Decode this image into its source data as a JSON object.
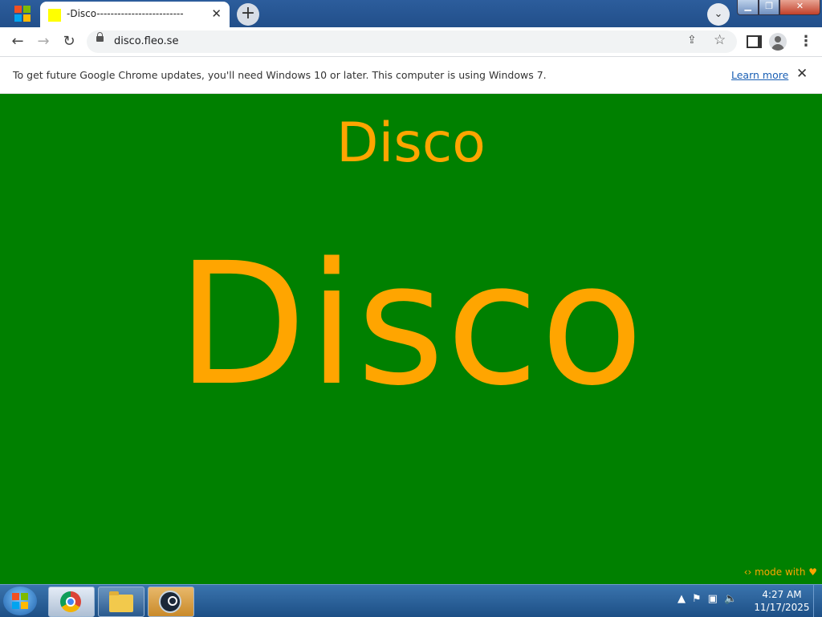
{
  "browser": {
    "tab_title": "-Disco-------------------------",
    "tab_close": "✕",
    "new_tab": "+",
    "url": "disco.fleo.se"
  },
  "toolbar": {
    "back": "←",
    "forward": "→",
    "reload": "↻",
    "share": "⇪",
    "star": "☆",
    "menu": "⋮"
  },
  "infobar": {
    "message": "To get future Google Chrome updates, you'll need Windows 10 or later. This computer is using Windows 7.",
    "link": "Learn more",
    "close": "✕"
  },
  "page": {
    "heading_small": "Disco",
    "heading_big": "Disco",
    "credit": "‹› mode with ♥",
    "background_color": "#008000",
    "text_color": "#ffa500"
  },
  "taskbar": {
    "time": "4:27 AM",
    "date": "11/17/2025",
    "tray_arrow": "▲"
  }
}
